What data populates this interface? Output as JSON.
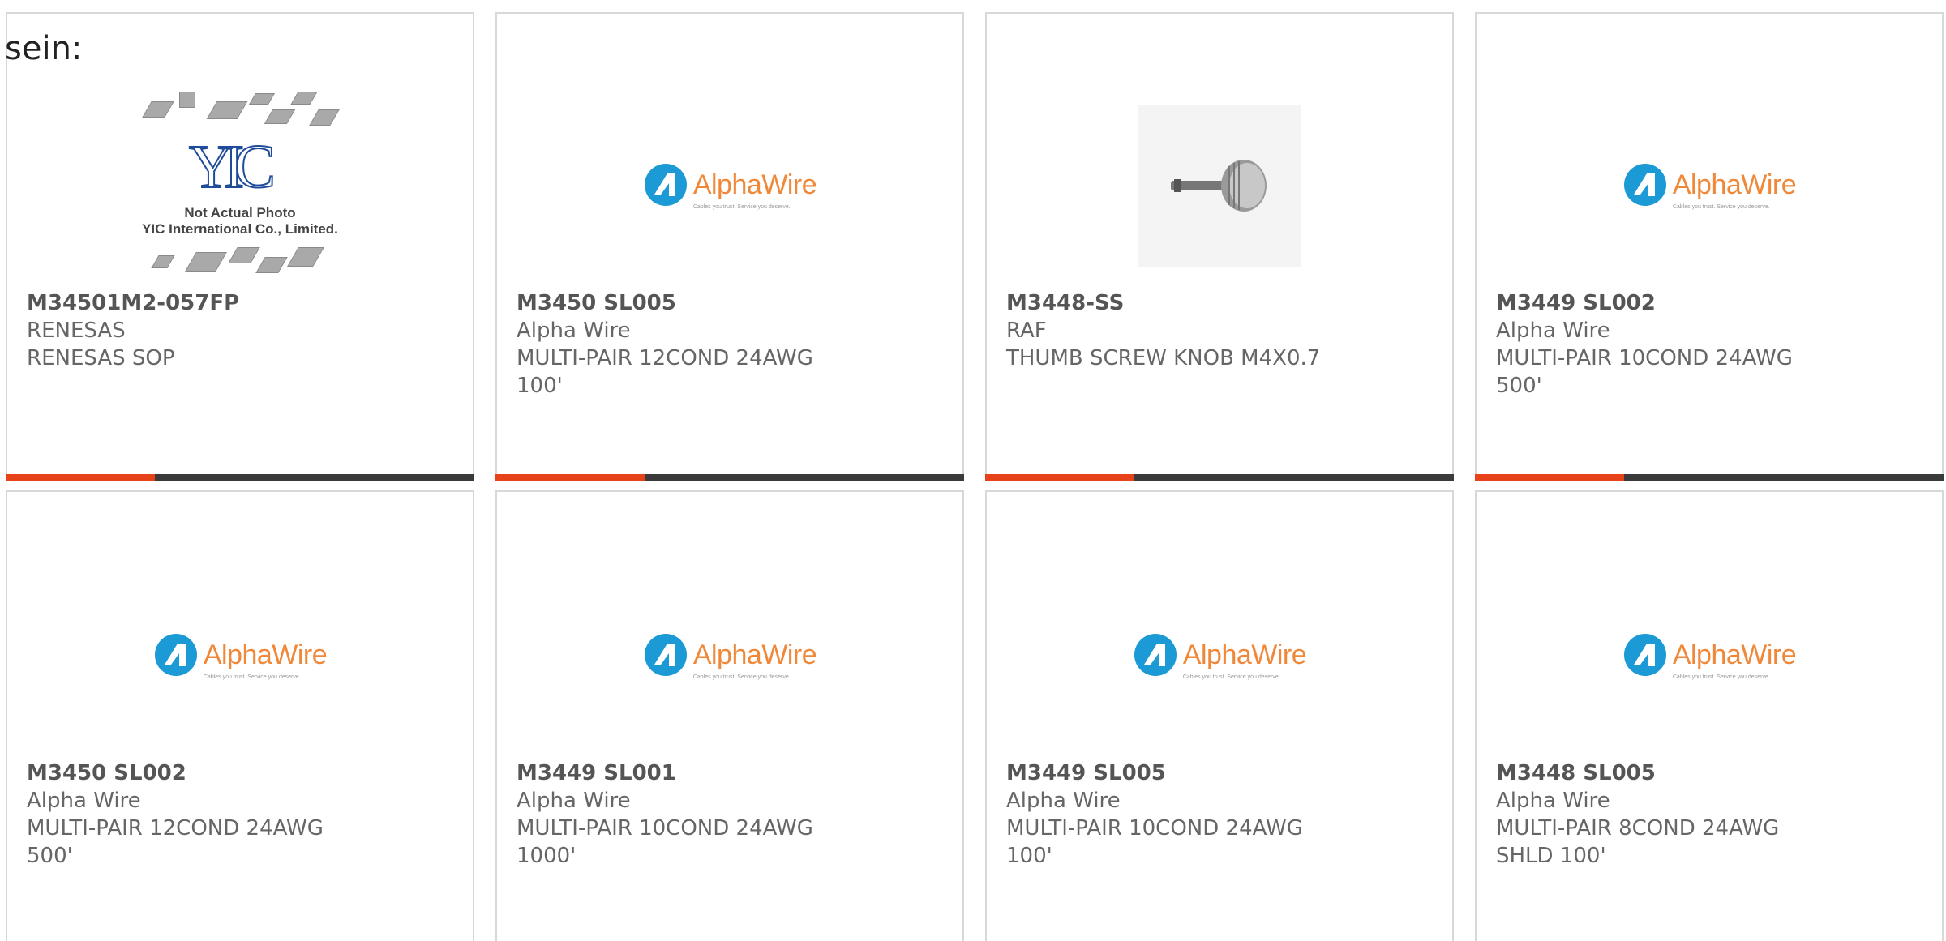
{
  "lead_text": "sein:",
  "colors": {
    "accent": "#e8421b",
    "bar": "#3a3a3a",
    "alpha_blue": "#1b9ad6",
    "alpha_orange": "#f0883a",
    "yic_blue": "#1e4b9a"
  },
  "products": [
    {
      "part": "M34501M2-057FP",
      "maker": "RENESAS",
      "desc1": "RENESAS SOP",
      "desc2": "",
      "image": "yic-placeholder",
      "image_text": {
        "logo": "YIC",
        "line1": "Not Actual Photo",
        "line2": "YIC International Co., Limited."
      }
    },
    {
      "part": "M3450 SL005",
      "maker": "Alpha Wire",
      "desc1": "MULTI-PAIR 12COND 24AWG",
      "desc2": "100'",
      "image": "alphawire-logo"
    },
    {
      "part": "M3448-SS",
      "maker": "RAF",
      "desc1": "THUMB SCREW KNOB M4X0.7",
      "desc2": "",
      "image": "thumb-screw-photo"
    },
    {
      "part": "M3449 SL002",
      "maker": "Alpha Wire",
      "desc1": "MULTI-PAIR 10COND 24AWG",
      "desc2": "500'",
      "image": "alphawire-logo"
    },
    {
      "part": "M3450 SL002",
      "maker": "Alpha Wire",
      "desc1": "MULTI-PAIR 12COND 24AWG",
      "desc2": "500'",
      "image": "alphawire-logo"
    },
    {
      "part": "M3449 SL001",
      "maker": "Alpha Wire",
      "desc1": "MULTI-PAIR 10COND 24AWG",
      "desc2": "1000'",
      "image": "alphawire-logo"
    },
    {
      "part": "M3449 SL005",
      "maker": "Alpha Wire",
      "desc1": "MULTI-PAIR 10COND 24AWG",
      "desc2": "100'",
      "image": "alphawire-logo"
    },
    {
      "part": "M3448 SL005",
      "maker": "Alpha Wire",
      "desc1": "MULTI-PAIR 8COND 24AWG",
      "desc2": "SHLD 100'",
      "image": "alphawire-logo"
    }
  ],
  "alphawire_logo": {
    "name": "AlphaWire",
    "tagline": "Cables you trust. Service you deserve."
  }
}
